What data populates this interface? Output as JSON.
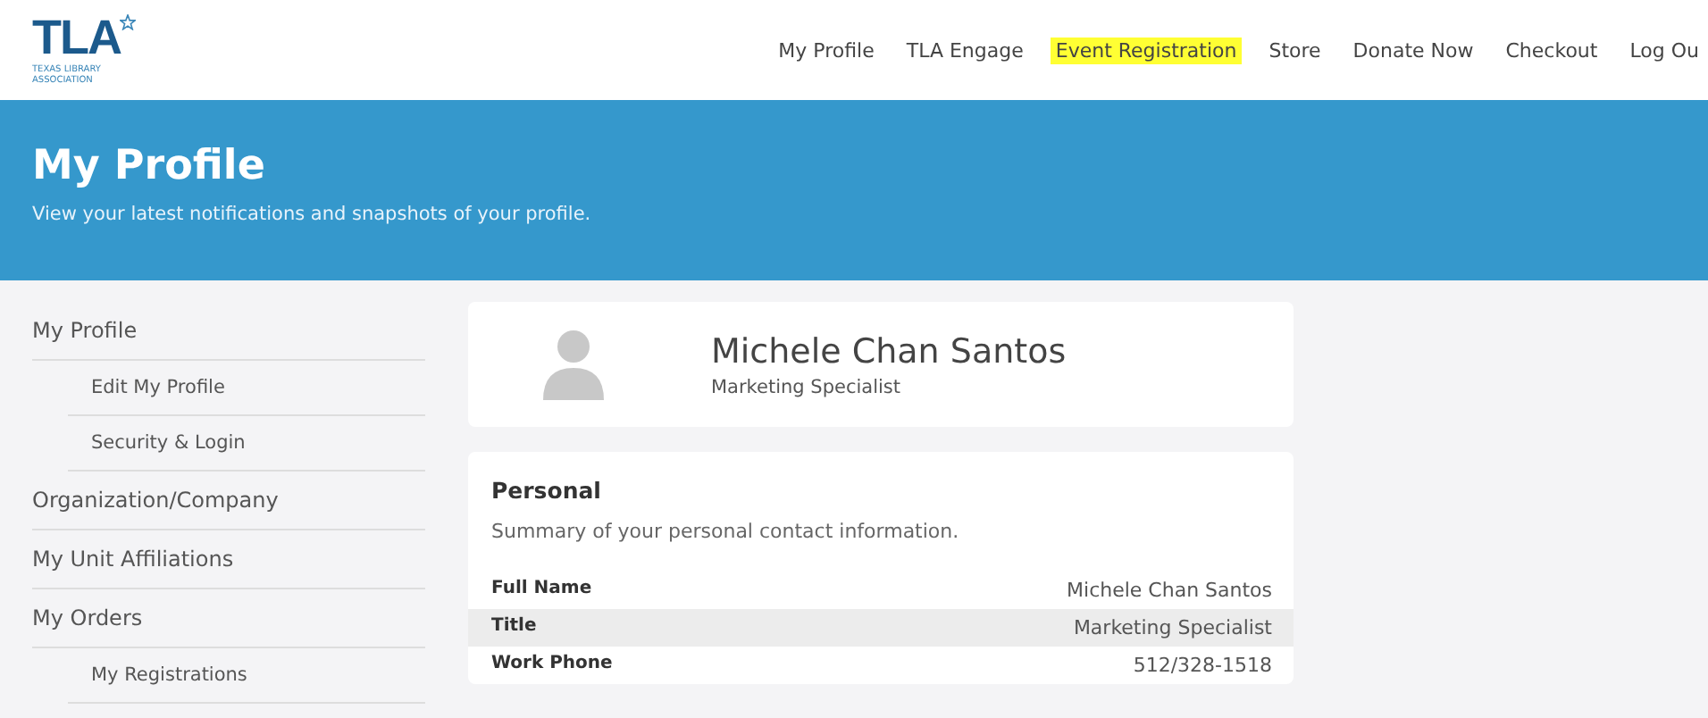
{
  "logo": {
    "mark": "TLA",
    "subtitle": "TEXAS LIBRARY ASSOCIATION"
  },
  "nav": [
    {
      "label": "My Profile",
      "highlighted": false
    },
    {
      "label": "TLA Engage",
      "highlighted": false
    },
    {
      "label": "Event Registration",
      "highlighted": true
    },
    {
      "label": "Store",
      "highlighted": false
    },
    {
      "label": "Donate Now",
      "highlighted": false
    },
    {
      "label": "Checkout",
      "highlighted": false
    },
    {
      "label": "Log Ou",
      "highlighted": false
    }
  ],
  "banner": {
    "title": "My Profile",
    "subtitle": "View your latest notifications and snapshots of your profile."
  },
  "sidebar": {
    "items": [
      {
        "label": "My Profile",
        "children": [
          {
            "label": "Edit My Profile"
          },
          {
            "label": "Security & Login"
          }
        ]
      },
      {
        "label": "Organization/Company"
      },
      {
        "label": "My Unit Affiliations"
      },
      {
        "label": "My Orders",
        "children": [
          {
            "label": "My Registrations"
          }
        ]
      }
    ]
  },
  "profile": {
    "name": "Michele Chan Santos",
    "title": "Marketing Specialist"
  },
  "personal": {
    "heading": "Personal",
    "description": "Summary of your personal contact information.",
    "rows": [
      {
        "label": "Full Name",
        "value": "Michele Chan Santos"
      },
      {
        "label": "Title",
        "value": "Marketing Specialist"
      },
      {
        "label": "Work Phone",
        "value": "512/328-1518"
      }
    ]
  }
}
